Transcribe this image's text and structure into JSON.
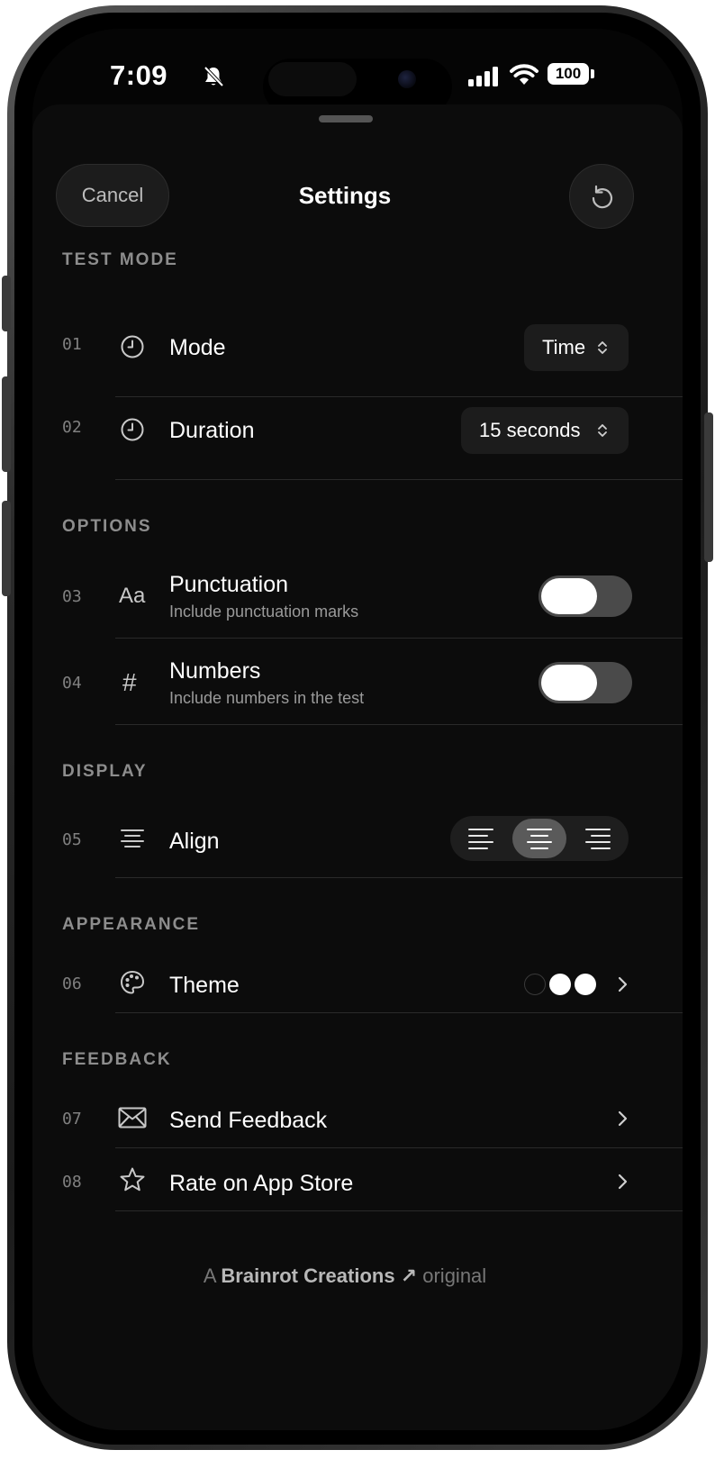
{
  "status_bar": {
    "time": "7:09",
    "battery": "100"
  },
  "header": {
    "cancel_label": "Cancel",
    "title": "Settings"
  },
  "sections": {
    "test_mode": "TEST MODE",
    "options": "OPTIONS",
    "display": "DISPLAY",
    "appearance": "APPEARANCE",
    "feedback": "FEEDBACK"
  },
  "rows": [
    {
      "num": "01",
      "label": "Mode",
      "value": "Time"
    },
    {
      "num": "02",
      "label": "Duration",
      "value": "15 seconds"
    },
    {
      "num": "03",
      "icon_text": "Aa",
      "label": "Punctuation",
      "sub": "Include punctuation marks",
      "toggle_on": true
    },
    {
      "num": "04",
      "icon_text": "#",
      "label": "Numbers",
      "sub": "Include numbers in the test",
      "toggle_on": true
    },
    {
      "num": "05",
      "label": "Align",
      "options": [
        "left",
        "center",
        "right"
      ],
      "selected": "center"
    },
    {
      "num": "06",
      "label": "Theme"
    },
    {
      "num": "07",
      "label": "Send Feedback"
    },
    {
      "num": "08",
      "label": "Rate on App Store"
    }
  ],
  "icons": {
    "mode": "clock-icon",
    "duration": "clock-icon",
    "punctuation": "text-aa-icon",
    "numbers": "hash-icon",
    "align": "align-center-icon",
    "theme": "palette-icon",
    "feedback": "envelope-icon",
    "rate": "star-icon"
  },
  "theme_swatches": [
    "#000000",
    "#ffffff",
    "#ffffff"
  ],
  "footer": {
    "prefix": "A",
    "brand": "Brainrot Creations",
    "arrow": "↗",
    "suffix": "original"
  }
}
